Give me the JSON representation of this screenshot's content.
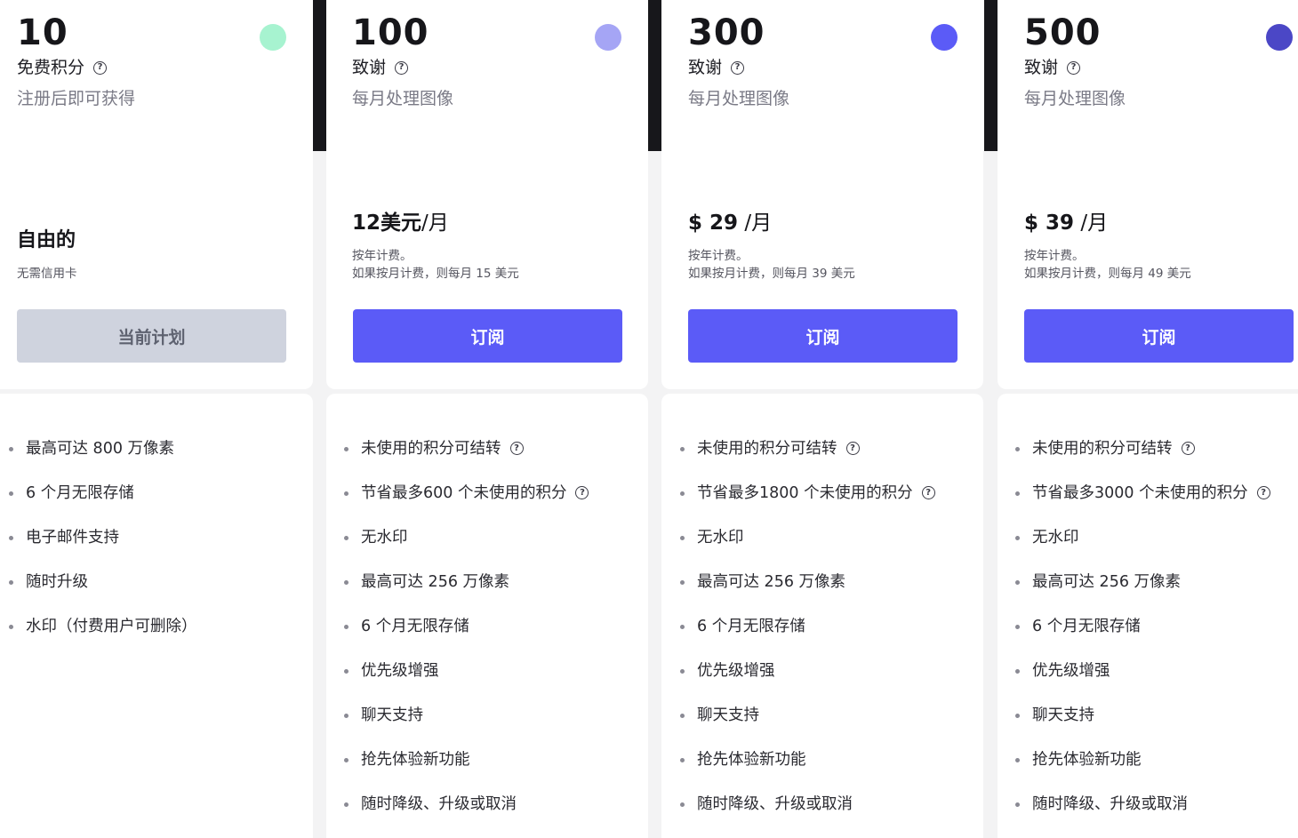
{
  "plans": [
    {
      "credits": "10",
      "unit_label": "免费积分",
      "subtitle": "注册后即可获得",
      "price_title": "自由的",
      "note": "无需信用卡",
      "button_label": "当前计划",
      "dot_color": "#a7f3d0",
      "features": [
        "最高可达 800 万像素",
        "6 个月无限存储",
        "电子邮件支持",
        "随时升级",
        "水印（付费用户可删除）"
      ]
    },
    {
      "credits": "100",
      "unit_label": "致谢",
      "subtitle": "每月处理图像",
      "price_main": "12美元",
      "price_suffix": "/月",
      "note_line1": "按年计费。",
      "note_line2": "如果按月计费，则每月 15 美元",
      "button_label": "订阅",
      "dot_color": "#a5a5f5",
      "features": [
        "未使用的积分可结转",
        "节省最多600 个未使用的积分",
        "无水印",
        "最高可达 256 万像素",
        "6 个月无限存储",
        "优先级增强",
        "聊天支持",
        "抢先体验新功能",
        "随时降级、升级或取消"
      ]
    },
    {
      "credits": "300",
      "unit_label": "致谢",
      "subtitle": "每月处理图像",
      "price_main": "$ 29",
      "price_suffix": " /月",
      "note_line1": "按年计费。",
      "note_line2": "如果按月计费，则每月 39 美元",
      "button_label": "订阅",
      "dot_color": "#5b5bf7",
      "features": [
        "未使用的积分可结转",
        "节省最多1800 个未使用的积分",
        "无水印",
        "最高可达 256 万像素",
        "6 个月无限存储",
        "优先级增强",
        "聊天支持",
        "抢先体验新功能",
        "随时降级、升级或取消"
      ]
    },
    {
      "credits": "500",
      "unit_label": "致谢",
      "subtitle": "每月处理图像",
      "price_main": "$ 39",
      "price_suffix": " /月",
      "note_line1": "按年计费。",
      "note_line2": "如果按月计费，则每月 49 美元",
      "button_label": "订阅",
      "dot_color": "#4b47c6",
      "features": [
        "未使用的积分可结转",
        "节省最多3000 个未使用的积分",
        "无水印",
        "最高可达 256 万像素",
        "6 个月无限存储",
        "优先级增强",
        "聊天支持",
        "抢先体验新功能",
        "随时降级、升级或取消"
      ]
    }
  ],
  "colors": {
    "accent": "#5b5bf7",
    "current_button_bg": "#cfd3de"
  },
  "icons": {
    "help": "help-circle-icon"
  }
}
